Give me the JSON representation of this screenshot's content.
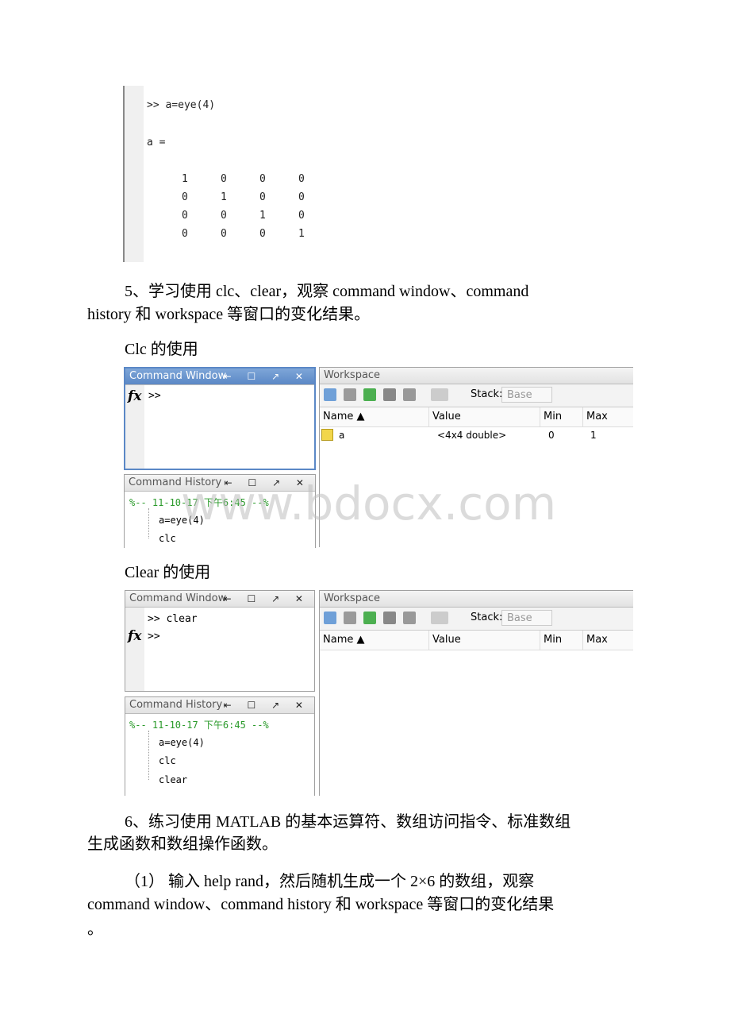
{
  "matrix_shot": {
    "command": ">>  a=eye(4)",
    "result_label": "a =",
    "matrix": [
      [
        "1",
        "0",
        "0",
        "0"
      ],
      [
        "0",
        "1",
        "0",
        "0"
      ],
      [
        "0",
        "0",
        "1",
        "0"
      ],
      [
        "0",
        "0",
        "0",
        "1"
      ]
    ]
  },
  "para5": {
    "line1": "5、学习使用 clc、clear，观察 command window、command",
    "line2": "history 和 workspace 等窗口的变化结果。"
  },
  "clc_heading": "Clc 的使用",
  "clear_heading": "Clear 的使用",
  "para6": {
    "line1": "6、练习使用 MATLAB 的基本运算符、数组访问指令、标准数组",
    "line2": "生成函数和数组操作函数。"
  },
  "item1": {
    "line1": "（1） 输入 help rand，然后随机生成一个 2×6 的数组，观察",
    "line2": "command window、command history 和 workspace 等窗口的变化结果",
    "line3": "。"
  },
  "watermark": "www.bdocx.com",
  "matlab": {
    "command_window_title": "Command Window",
    "command_history_title": "Command History",
    "workspace_title": "Workspace",
    "controls": "⇤ ☐ ↗ ✕",
    "fx": "fx",
    "prompt": ">>",
    "stack_label": "Stack:",
    "stack_value": "Base",
    "columns": [
      "Name ▲",
      "Value",
      "Min",
      "Max"
    ],
    "clc": {
      "history_header": "%-- 11-10-17  下午6:45 --%",
      "history": [
        "a=eye(4)",
        "clc"
      ],
      "variables": [
        {
          "name": "a",
          "value": "<4x4 double>",
          "min": "0",
          "max": "1"
        }
      ]
    },
    "clear": {
      "prev_command": ">> clear",
      "history_header": "%-- 11-10-17  下午6:45 --%",
      "history": [
        "a=eye(4)",
        "clc",
        "clear"
      ]
    },
    "colors": {
      "active_title": "#5b88c6",
      "history_green": "#2a9a2a",
      "variable_icon": "#f2d64b"
    }
  }
}
